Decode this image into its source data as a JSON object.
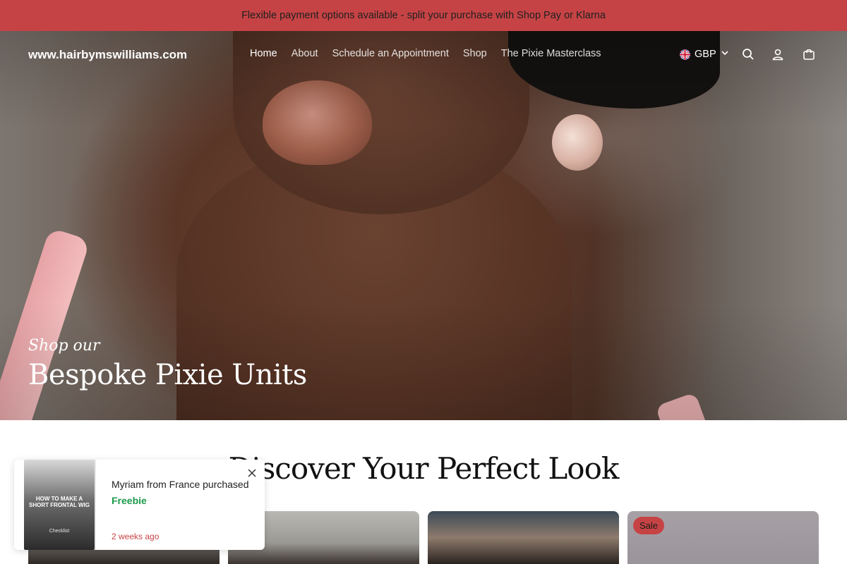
{
  "announcement": {
    "text": "Flexible payment options available - split your purchase with Shop Pay or Klarna"
  },
  "header": {
    "logo": "www.hairbymswilliams.com",
    "nav": [
      {
        "label": "Home",
        "active": true
      },
      {
        "label": "About"
      },
      {
        "label": "Schedule an Appointment"
      },
      {
        "label": "Shop"
      },
      {
        "label": "The Pixie Masterclass"
      }
    ],
    "currency": {
      "code": "GBP",
      "flag_icon": "uk-flag-icon"
    },
    "icons": [
      "search-icon",
      "account-icon",
      "cart-icon"
    ]
  },
  "hero": {
    "subtitle": "Shop our",
    "title": "Bespoke Pixie Units"
  },
  "collection": {
    "title": "Discover Your Perfect Look",
    "cards": [
      {
        "badge": ""
      },
      {
        "badge": ""
      },
      {
        "badge": ""
      },
      {
        "badge": "Sale"
      }
    ]
  },
  "notification": {
    "thumb_title": "HOW TO MAKE A SHORT FRONTAL WIG",
    "thumb_sub": "Checklist",
    "text": "Myriam from France purchased",
    "product": "Freebie",
    "time": "2 weeks ago"
  },
  "colors": {
    "accent": "#c64345",
    "product_green": "#1d9a4a"
  }
}
